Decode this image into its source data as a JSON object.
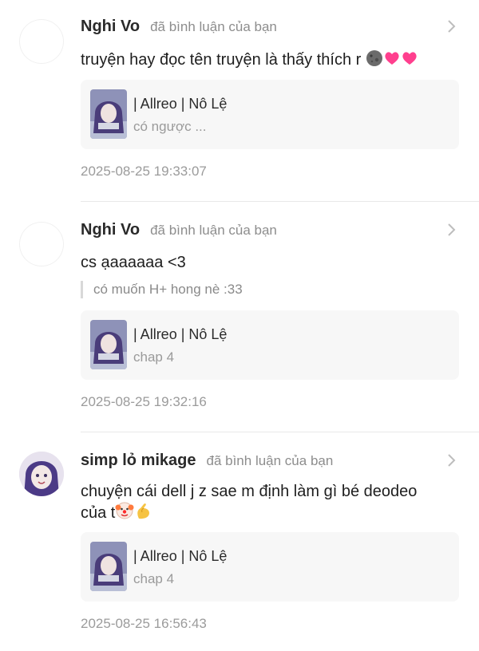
{
  "notifications": [
    {
      "user": "Nghi Vo",
      "action": "đã bình luận của bạn",
      "comment": "truyện hay đọc tên truyện là thấy thích r",
      "emojis": [
        "moon-face-icon",
        "heart-icon",
        "heart-icon"
      ],
      "quote": "",
      "story_title": "| Allreo | Nô Lệ",
      "story_sub": "có ngược ...",
      "time": "2025-08-25 19:33:07"
    },
    {
      "user": "Nghi Vo",
      "action": "đã bình luận của bạn",
      "comment": "cs ạaaaaaa <3",
      "quote": "có muốn H+ hong nè :33",
      "story_title": "| Allreo | Nô Lệ",
      "story_sub": "chap 4",
      "time": "2025-08-25 19:32:16"
    },
    {
      "user": "simp lỏ mikage",
      "action": "đã bình luận của bạn",
      "comment_line1": "chuyện cái dell j z sae m định làm gì bé deodeo",
      "comment_line2": "của t",
      "emojis": [
        "clown-face-icon",
        "pinching-hand-icon"
      ],
      "story_title": "| Allreo | Nô Lệ",
      "story_sub": "chap 4",
      "time": "2025-08-25 16:56:43"
    }
  ],
  "colors": {
    "name": "#2a2a2a",
    "muted": "#8d8d8d",
    "card_bg": "#f7f7f7",
    "heart": "#ff3f8e"
  }
}
